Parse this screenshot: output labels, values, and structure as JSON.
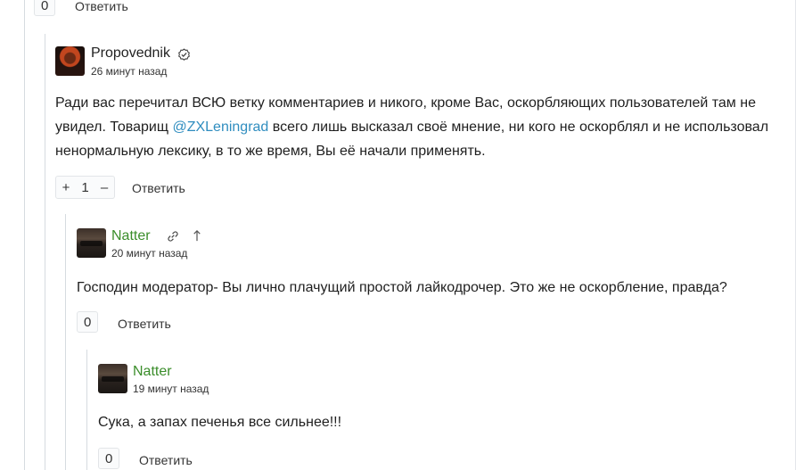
{
  "top_reply": {
    "score": "0",
    "reply_label": "Ответить"
  },
  "comments": [
    {
      "author": "Propovednik",
      "time": "26 минут назад",
      "text_before_mention": "Ради вас перечитал ВСЮ ветку комментариев и никого, кроме Вас, оскорбляющих пользователей там не увидел. Товарищ ",
      "mention": "@ZXLeningrad",
      "text_after_mention": " всего лишь высказал своё мнение, ни кого не оскорблял и не использовал ненормальную лексику, в то же время, Вы её начали применять.",
      "vote_plus": "+",
      "score": "1",
      "vote_minus": "–",
      "reply_label": "Ответить"
    },
    {
      "author": "Natter",
      "time": "20 минут назад",
      "text": "Господин модератор- Вы лично плачущий простой лайкодрочер. Это же не оскорбление, правда?",
      "score": "0",
      "reply_label": "Ответить"
    },
    {
      "author": "Natter",
      "time": "19 минут назад",
      "text": "Сука, а запах печенья все сильнее!!!",
      "score": "0",
      "reply_label": "Ответить"
    }
  ],
  "icons": {
    "verified": "verified-check-icon",
    "link": "link-icon",
    "parent": "arrow-up-icon"
  }
}
